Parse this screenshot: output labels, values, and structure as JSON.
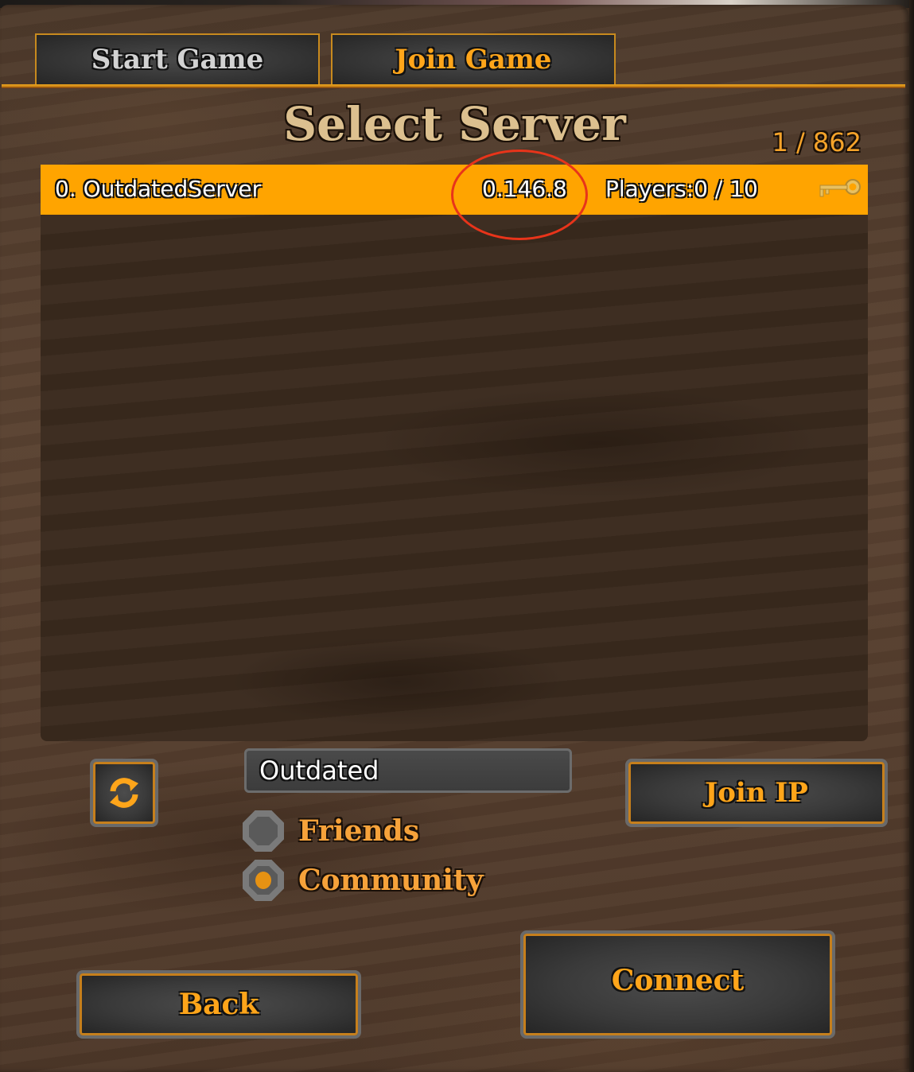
{
  "tabs": [
    {
      "label": "Start Game",
      "active": false
    },
    {
      "label": "Join Game",
      "active": true
    }
  ],
  "title": "Select Server",
  "server_count": "1 / 862",
  "servers": [
    {
      "name": "0. OutdatedServer",
      "version": "0.146.8",
      "players": "Players:0 / 10",
      "icon": "key-icon",
      "password_protected": true,
      "selected": true
    }
  ],
  "filter": {
    "value": "Outdated"
  },
  "refresh": {
    "icon": "refresh-icon"
  },
  "source_options": [
    {
      "label": "Friends",
      "selected": false
    },
    {
      "label": "Community",
      "selected": true
    }
  ],
  "buttons": {
    "join_ip": "Join IP",
    "back": "Back",
    "connect": "Connect"
  },
  "colors": {
    "accent": "#ffa400",
    "annotation": "#e8341a",
    "title": "#dcc08f"
  }
}
